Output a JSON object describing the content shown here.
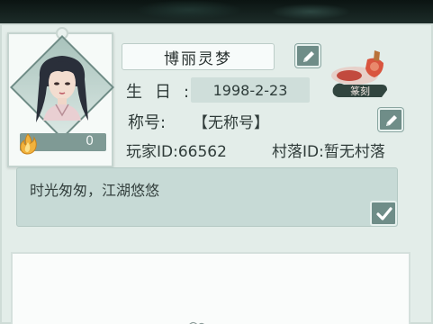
{
  "profile": {
    "name": "博丽灵梦",
    "birthday_label": "生日:",
    "birthday_value": "1998-2-23",
    "title_label": "称号:",
    "title_value": "【无称号】",
    "player_id": "玩家ID:66562",
    "village_id": "村落ID:暂无村落",
    "fame_value": "0"
  },
  "signature": {
    "text": "时光匆匆，江湖悠悠"
  },
  "seal": {
    "label": "篆刻"
  },
  "icons": {
    "edit": "edit-pencil-icon",
    "confirm": "checkmark-icon",
    "fame": "flame-icon"
  },
  "colors": {
    "panel_bg": "#e3ede9",
    "button": "#6f8d88",
    "signature_bg": "#c7dad6",
    "seal_red": "#b63a2f"
  }
}
